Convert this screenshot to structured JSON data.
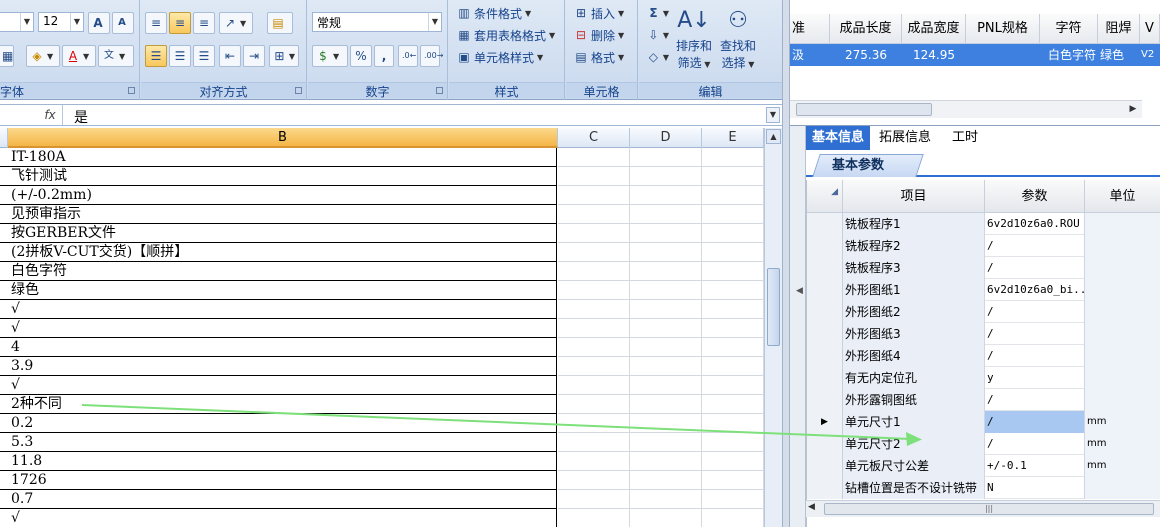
{
  "ribbon": {
    "font": {
      "size": "12",
      "label": "字体"
    },
    "alignment": {
      "label": "对齐方式"
    },
    "number": {
      "format": "常规",
      "label": "数字",
      "percent": "%",
      "comma": ","
    },
    "styles": {
      "conditional": "条件格式",
      "table_format": "套用表格格式",
      "cell_style": "单元格样式",
      "label": "样式"
    },
    "cells": {
      "insert": "插入",
      "delete": "删除",
      "format": "格式",
      "label": "单元格"
    },
    "editing": {
      "sigma": "Σ",
      "sort_line1": "排序和",
      "sort_line2": "筛选",
      "find_line1": "查找和",
      "find_line2": "选择",
      "label": "编辑"
    }
  },
  "formula_bar": {
    "fx": "fx",
    "value": "是"
  },
  "columns": [
    "B",
    "C",
    "D",
    "E"
  ],
  "cells_b": [
    "IT-180A",
    "飞针测试",
    "(+/-0.2mm)",
    "见预审指示",
    "按GERBER文件",
    "(2拼板V-CUT交货)【顺拼】",
    "白色字符",
    "绿色",
    "√",
    "√",
    "4",
    "3.9",
    "√",
    "2种不同",
    "0.2",
    "5.3",
    "11.8",
    "1726",
    "0.7",
    "√"
  ],
  "top_table": {
    "headers": [
      "准",
      "成品长度",
      "成品宽度",
      "PNL规格",
      "字符",
      "阻焊",
      "V"
    ],
    "row": [
      "汲",
      "275.36",
      "124.95",
      "",
      "白色字符",
      "绿色",
      "V2"
    ]
  },
  "tabs": [
    "基本信息",
    "拓展信息",
    "工时"
  ],
  "subtab": "基本参数",
  "param_headers": {
    "item": "项目",
    "param": "参数",
    "unit": "单位"
  },
  "params": [
    {
      "name": "铣板程序1",
      "value": "6v2d10z6a0.ROU",
      "unit": ""
    },
    {
      "name": "铣板程序2",
      "value": "/",
      "unit": ""
    },
    {
      "name": "铣板程序3",
      "value": "/",
      "unit": ""
    },
    {
      "name": "外形图纸1",
      "value": "6v2d10z6a0_bi...",
      "unit": ""
    },
    {
      "name": "外形图纸2",
      "value": "/",
      "unit": ""
    },
    {
      "name": "外形图纸3",
      "value": "/",
      "unit": ""
    },
    {
      "name": "外形图纸4",
      "value": "/",
      "unit": ""
    },
    {
      "name": "有无内定位孔",
      "value": "y",
      "unit": ""
    },
    {
      "name": "外形露铜图纸",
      "value": "/",
      "unit": ""
    },
    {
      "name": "单元尺寸1",
      "value": "/",
      "unit": "mm"
    },
    {
      "name": "单元尺寸2",
      "value": "/",
      "unit": "mm"
    },
    {
      "name": "单元板尺寸公差",
      "value": "+/-0.1",
      "unit": "mm"
    },
    {
      "name": "钻槽位置是否不设计铣带",
      "value": "N",
      "unit": ""
    }
  ]
}
